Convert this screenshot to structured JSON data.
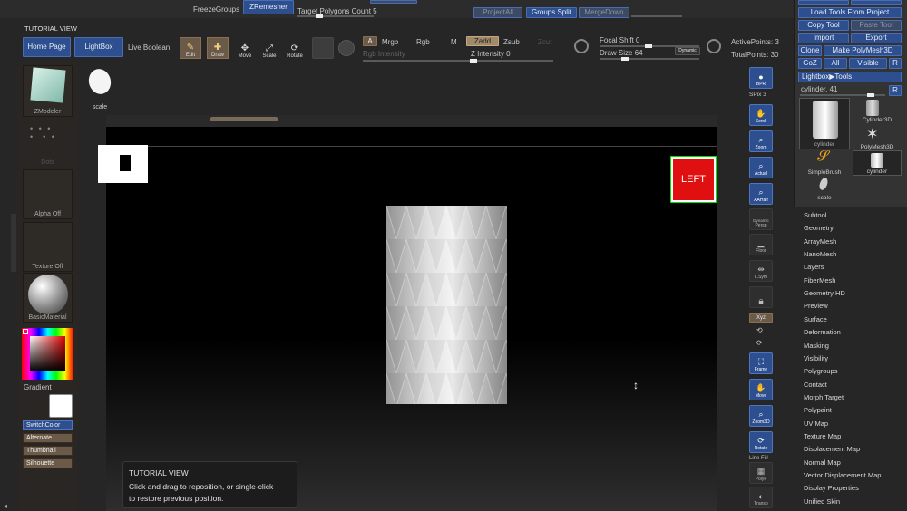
{
  "top_strip": {
    "freeze_groups": "FreezeGroups",
    "zremesher": "ZRemesher",
    "target_polygons_label": "Target Polygons Count",
    "target_polygons_value": "5",
    "project_all": "ProjectAll",
    "groups_split": "Groups Split",
    "merge_down": "MergeDown"
  },
  "tutorial_header": "TUTORIAL VIEW",
  "nav": {
    "home_page": "Home Page",
    "lightbox": "LightBox",
    "live_boolean": "Live Boolean"
  },
  "modes": {
    "edit": "Edit",
    "draw": "Draw",
    "move": "Move",
    "scale": "Scale",
    "rotate": "Rotate"
  },
  "channels": {
    "a": "A",
    "mrgb": "Mrgb",
    "rgb": "Rgb",
    "m": "M",
    "zadd": "Zadd",
    "zsub": "Zsub",
    "zcut": "Zcut",
    "rgb_intensity": "Rgb Intensity",
    "z_intensity_label": "Z Intensity",
    "z_intensity_value": "0"
  },
  "focal": {
    "focal_shift_label": "Focal Shift",
    "focal_shift_value": "0",
    "draw_size_label": "Draw Size",
    "draw_size_value": "64",
    "dynamic": "Dynamic"
  },
  "points": {
    "active_label": "ActivePoints:",
    "active_value": "3",
    "total_label": "TotalPoints:",
    "total_value": "30"
  },
  "tool_panel": {
    "load_tools_from_project": "Load Tools From Project",
    "copy_tool": "Copy Tool",
    "paste_tool": "Paste Tool",
    "import": "Import",
    "export": "Export",
    "clone": "Clone",
    "make_polymesh": "Make PolyMesh3D",
    "goz": "GoZ",
    "all": "All",
    "visible": "Visible",
    "r": "R",
    "lightbox_tools": "Lightbox▶Tools",
    "current_tool_label": "cylinder.",
    "current_tool_value": "41",
    "thumbs": [
      "cylinder",
      "Cylinder3D",
      "PolyMesh3D",
      "SimpleBrush",
      "cylinder",
      "scale"
    ]
  },
  "menu": [
    "Subtool",
    "Geometry",
    "ArrayMesh",
    "NanoMesh",
    "Layers",
    "FiberMesh",
    "Geometry HD",
    "Preview",
    "Surface",
    "Deformation",
    "Masking",
    "Visibility",
    "Polygroups",
    "Contact",
    "Morph Target",
    "Polypaint",
    "UV Map",
    "Texture Map",
    "Displacement Map",
    "Normal Map",
    "Vector Displacement Map",
    "Display Properties",
    "Unified Skin"
  ],
  "left_panel": {
    "zmodeler": "ZModeler",
    "brush_thumb": "scale",
    "dots": "Dots",
    "alpha_off": "Alpha Off",
    "texture_off": "Texture Off",
    "material": "BasicMaterial",
    "gradient": "Gradient",
    "switch_color": "SwitchColor",
    "alternate": "Alternate",
    "thumbnail": "Thumbnail",
    "silhouette": "Silhouette"
  },
  "right_shelf": {
    "bpr": "BPR",
    "spix_label": "SPix",
    "spix_value": "3",
    "scroll": "Scroll",
    "zoom": "Zoom",
    "actual": "Actual",
    "aahalf": "AAHalf",
    "dynamic": "Dynamic",
    "persp": "Persp",
    "floor": "Floor",
    "lsym": "L.Sym",
    "xyz": "Xyz",
    "frame": "Frame",
    "move": "Move",
    "zoom3d": "Zoom3D",
    "rotate": "Rotate",
    "line_fill": "Line Fill",
    "polyf": "PolyF",
    "transp": "Transp"
  },
  "viewport": {
    "orientation": "LEFT"
  },
  "tooltip": {
    "title": "TUTORIAL VIEW",
    "line1": "Click and drag to reposition, or single-click",
    "line2": "to restore previous position."
  },
  "colors": {
    "accent_blue": "#2d4f8f",
    "orientation_red": "#e01010"
  }
}
